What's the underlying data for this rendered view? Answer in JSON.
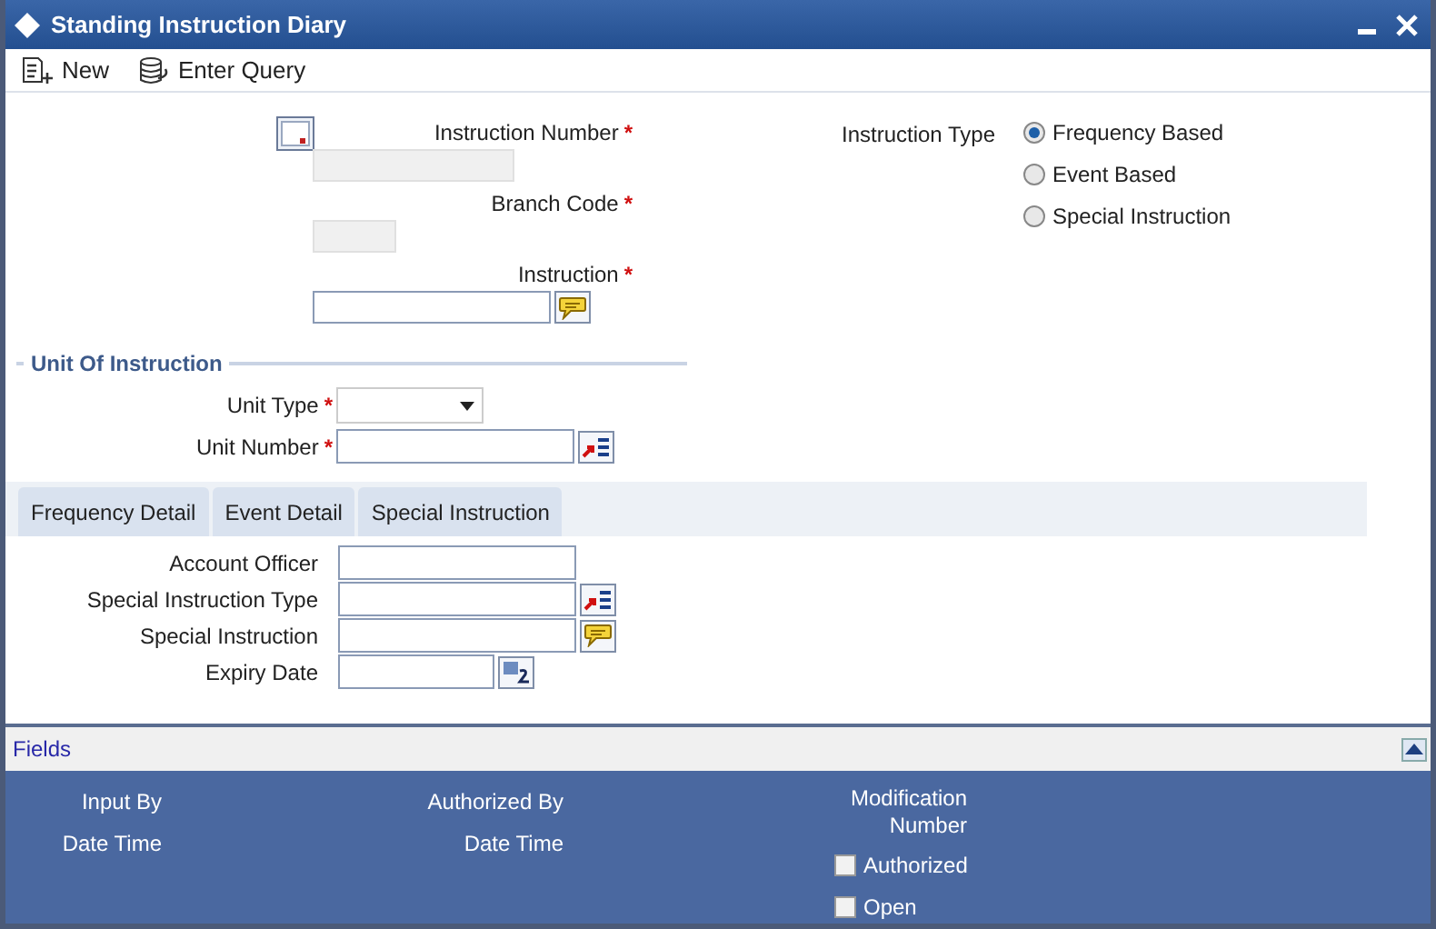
{
  "window": {
    "title": "Standing Instruction Diary"
  },
  "toolbar": [
    {
      "kind": "new",
      "label": "New"
    },
    {
      "kind": "query",
      "label": "Enter Query"
    }
  ],
  "header_fields": [
    {
      "label": "Instruction Number",
      "required": "*",
      "kind": "readonly"
    },
    {
      "label": "Branch Code",
      "required": "*",
      "kind": "readonly"
    },
    {
      "label": "Instruction",
      "required": "*",
      "kind": "text_note"
    }
  ],
  "instruction_type": {
    "label": "Instruction Type",
    "options": [
      {
        "label": "Frequency Based",
        "selected": true
      },
      {
        "label": "Event Based",
        "selected": false
      },
      {
        "label": "Special Instruction",
        "selected": false
      }
    ]
  },
  "unit_of_instruction": {
    "title": "Unit Of Instruction",
    "fields": [
      {
        "label": "Unit Type",
        "required": "*",
        "kind": "select"
      },
      {
        "label": "Unit Number",
        "required": "*",
        "kind": "lov"
      }
    ]
  },
  "tabs": [
    {
      "label": "Frequency Detail",
      "selected": false
    },
    {
      "label": "Event Detail",
      "selected": false
    },
    {
      "label": "Special Instruction",
      "selected": false
    }
  ],
  "detail_fields": [
    {
      "label": "Account Officer",
      "kind": "text"
    },
    {
      "label": "Special Instruction Type",
      "kind": "lov"
    },
    {
      "label": "Special Instruction",
      "kind": "note"
    },
    {
      "label": "Expiry Date",
      "kind": "date"
    }
  ],
  "fields_bar": {
    "label": "Fields"
  },
  "audit": {
    "col1": [
      "Input By",
      "Date Time"
    ],
    "col2": [
      "Authorized By",
      "Date Time"
    ],
    "col3": [
      "Modification",
      "Number"
    ],
    "checks": [
      {
        "label": "Authorized",
        "checked": false
      },
      {
        "label": "Open",
        "checked": false
      }
    ]
  }
}
